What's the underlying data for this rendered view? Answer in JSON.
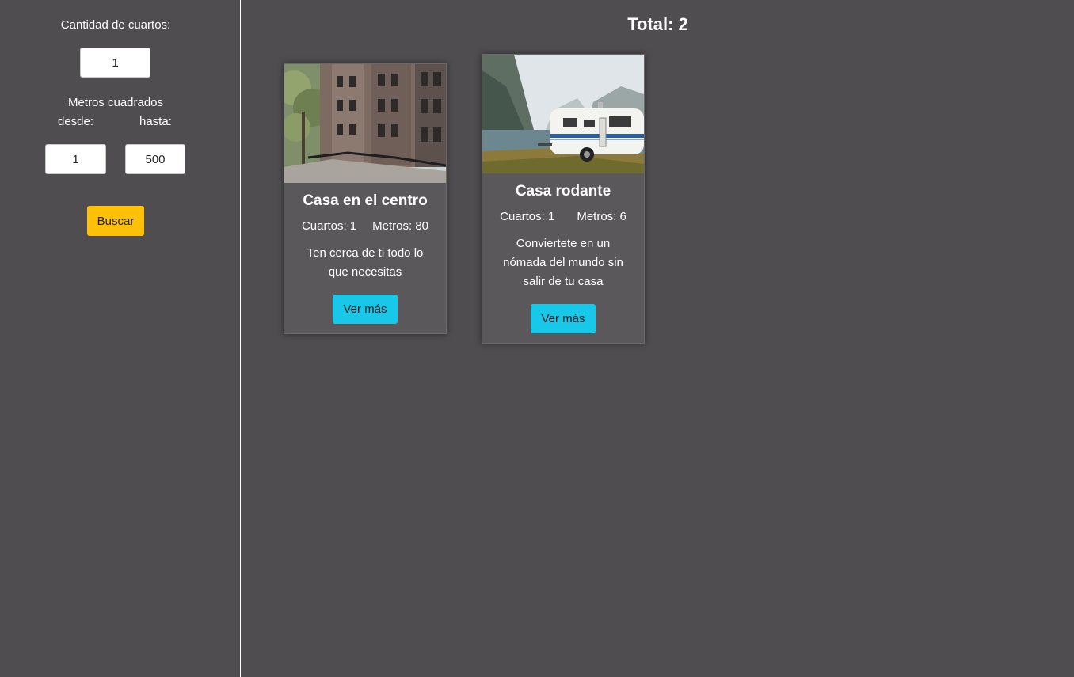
{
  "filters": {
    "rooms_label": "Cantidad de cuartos:",
    "rooms_value": "1",
    "area_label": "Metros cuadrados",
    "from_label": "desde:",
    "to_label": "hasta:",
    "from_value": "1",
    "to_value": "500",
    "search_button": "Buscar"
  },
  "results": {
    "total_text": "Total: 2"
  },
  "cards": [
    {
      "title": "Casa en el centro",
      "rooms": "Cuartos: 1",
      "meters": "Metros: 80",
      "description": "Ten cerca de ti todo lo que necesitas",
      "button": "Ver más"
    },
    {
      "title": "Casa rodante",
      "rooms": "Cuartos: 1",
      "meters": "Metros: 6",
      "description": "Conviertete en un nómada del mundo sin salir de tu casa",
      "button": "Ver más"
    }
  ],
  "colors": {
    "background": "#4f4d4f",
    "search_button": "#ffc107",
    "card_button": "#17c8e8"
  }
}
